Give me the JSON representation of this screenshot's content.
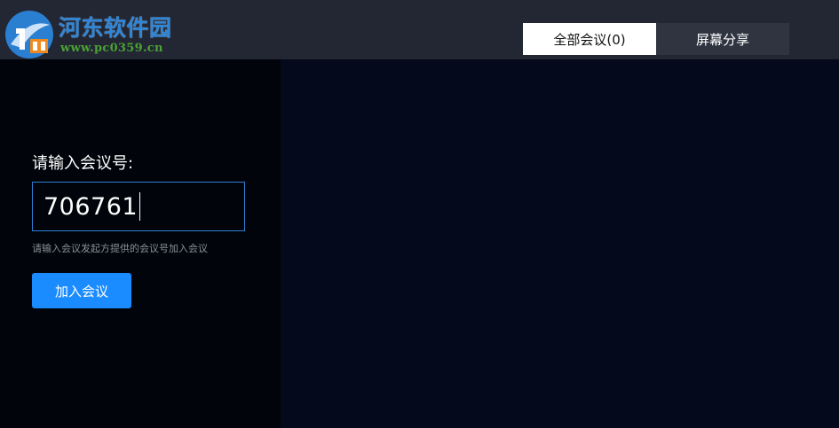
{
  "brand": {
    "name": "河东软件园",
    "url": "www.pc0359.cn",
    "icon": "site-logo-icon",
    "colors": {
      "name": "#2f86d8",
      "url": "#4aa234"
    }
  },
  "tabs": [
    {
      "label": "全部会议(0)",
      "active": true
    },
    {
      "label": "屏幕分享",
      "active": false
    }
  ],
  "join": {
    "label": "请输入会议号:",
    "input_value": "706761",
    "hint": "请输入会议发起方提供的会议号加入会议",
    "button_label": "加入会议"
  },
  "colors": {
    "accent": "#1a8cff",
    "topbar": "#222733",
    "left_panel": "#01050b",
    "right_panel": "#040a1b"
  }
}
